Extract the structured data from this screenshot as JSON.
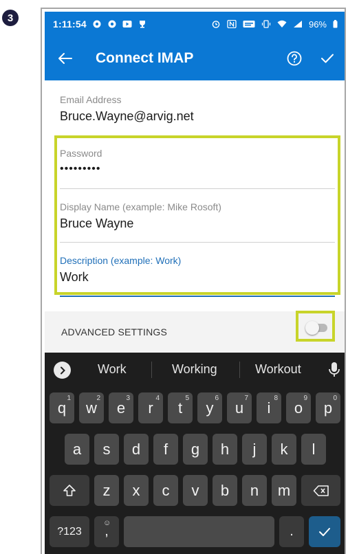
{
  "step_number": "3",
  "status_bar": {
    "time": "1:11:54",
    "battery": "96%"
  },
  "app_bar": {
    "title": "Connect IMAP",
    "back_icon": "arrow-left-icon",
    "help_icon": "help-circle-icon",
    "confirm_icon": "checkmark-icon"
  },
  "form": {
    "email": {
      "label": "Email Address",
      "value": "Bruce.Wayne@arvig.net"
    },
    "password": {
      "label": "Password",
      "value": "•••••••••"
    },
    "display_name": {
      "label": "Display Name (example: Mike Rosoft)",
      "value": "Bruce Wayne"
    },
    "description": {
      "label": "Description (example: Work)",
      "value": "Work"
    }
  },
  "advanced_settings": {
    "label": "ADVANCED SETTINGS",
    "enabled": false
  },
  "keyboard": {
    "suggestions": [
      "Work",
      "Working",
      "Workout"
    ],
    "row1": [
      {
        "k": "q",
        "h": "1"
      },
      {
        "k": "w",
        "h": "2"
      },
      {
        "k": "e",
        "h": "3"
      },
      {
        "k": "r",
        "h": "4"
      },
      {
        "k": "t",
        "h": "5"
      },
      {
        "k": "y",
        "h": "6"
      },
      {
        "k": "u",
        "h": "7"
      },
      {
        "k": "i",
        "h": "8"
      },
      {
        "k": "o",
        "h": "9"
      },
      {
        "k": "p",
        "h": "0"
      }
    ],
    "row2": [
      "a",
      "s",
      "d",
      "f",
      "g",
      "h",
      "j",
      "k",
      "l"
    ],
    "row3": [
      "z",
      "x",
      "c",
      "v",
      "b",
      "n",
      "m"
    ],
    "numbers_key": "?123",
    "comma_key": ",",
    "period_key": ".",
    "emoji_hint": "☺"
  },
  "colors": {
    "app_blue": "#0b78d4",
    "highlight": "#c8d42a",
    "focus_blue": "#1f6fb8"
  }
}
